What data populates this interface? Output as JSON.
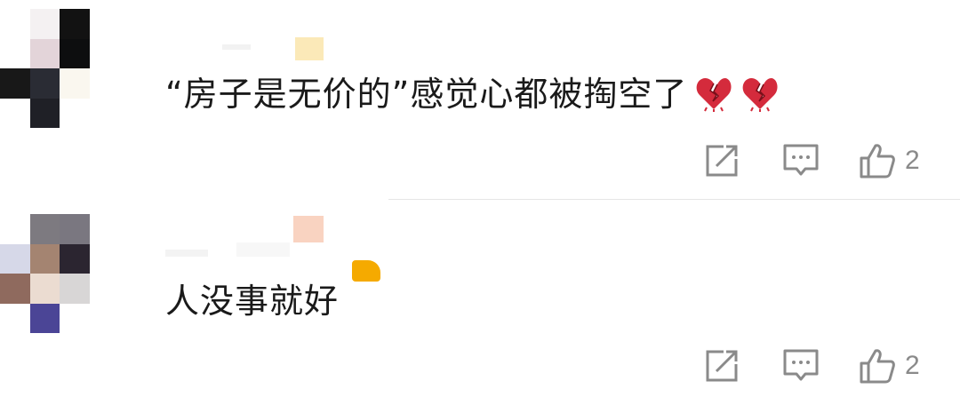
{
  "comments": [
    {
      "text": "“房子是无价的”感觉心都被掏空了",
      "emoji": [
        "broken-heart-icon",
        "broken-heart-icon"
      ],
      "likes": "2"
    },
    {
      "text": "人没事就好",
      "likes": "2"
    }
  ],
  "colors": {
    "text": "#1a1a1a",
    "icon": "#8a8a8a",
    "divider": "#e6e6e6",
    "heart": "#d42b3c",
    "badge_yellow": "#f5aa00"
  }
}
